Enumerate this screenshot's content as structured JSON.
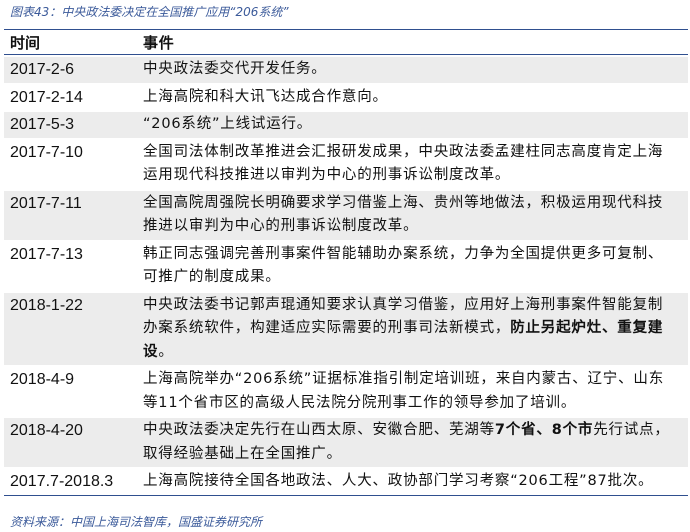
{
  "title": "图表43：中央政法委决定在全国推广应用“206系统”",
  "headers": {
    "time": "时间",
    "event": "事件"
  },
  "rows": [
    {
      "date": "2017-2-6",
      "segments": [
        {
          "text": "中央政法委交代开发任务。",
          "bold": false
        }
      ]
    },
    {
      "date": "2017-2-14",
      "segments": [
        {
          "text": "上海高院和科大讯飞达成合作意向。",
          "bold": false
        }
      ]
    },
    {
      "date": "2017-5-3",
      "segments": [
        {
          "text": "“206系统”上线试运行。",
          "bold": false
        }
      ]
    },
    {
      "date": "2017-7-10",
      "segments": [
        {
          "text": "全国司法体制改革推进会汇报研发成果，中央政法委孟建柱同志高度肯定上海运用现代科技推进以审判为中心的刑事诉讼制度改革。",
          "bold": false
        }
      ]
    },
    {
      "date": "2017-7-11",
      "segments": [
        {
          "text": "全国高院周强院长明确要求学习借鉴上海、贵州等地做法，积极运用现代科技推进以审判为中心的刑事诉讼制度改革。",
          "bold": false
        }
      ]
    },
    {
      "date": "2017-7-13",
      "segments": [
        {
          "text": "韩正同志强调完善刑事案件智能辅助办案系统，力争为全国提供更多可复制、可推广的制度成果。",
          "bold": false
        }
      ]
    },
    {
      "date": "2018-1-22",
      "segments": [
        {
          "text": "中央政法委书记郭声琨通知要求认真学习借鉴，应用好上海刑事案件智能复制办案系统软件，构建适应实际需要的刑事司法新模式，",
          "bold": false
        },
        {
          "text": "防止另起炉灶、重复建设",
          "bold": true
        },
        {
          "text": "。",
          "bold": false
        }
      ]
    },
    {
      "date": "2018-4-9",
      "segments": [
        {
          "text": "上海高院举办“206系统”证据标准指引制定培训班，来自内蒙古、辽宁、山东等11个省市区的高级人民法院分院刑事工作的领导参加了培训。",
          "bold": false
        }
      ]
    },
    {
      "date": "2018-4-20",
      "segments": [
        {
          "text": "中央政法委决定先行在山西太原、安徽合肥、芜湖等",
          "bold": false
        },
        {
          "text": "7个省、8个市",
          "bold": true
        },
        {
          "text": "先行试点，取得经验基础上在全国推广。",
          "bold": false
        }
      ]
    },
    {
      "date": "2017.7-2018.3",
      "segments": [
        {
          "text": "上海高院接待全国各地政法、人大、政协部门学习考察“206工程”87批次。",
          "bold": false
        }
      ]
    }
  ],
  "source": "资料来源：中国上海司法智库，国盛证券研究所"
}
